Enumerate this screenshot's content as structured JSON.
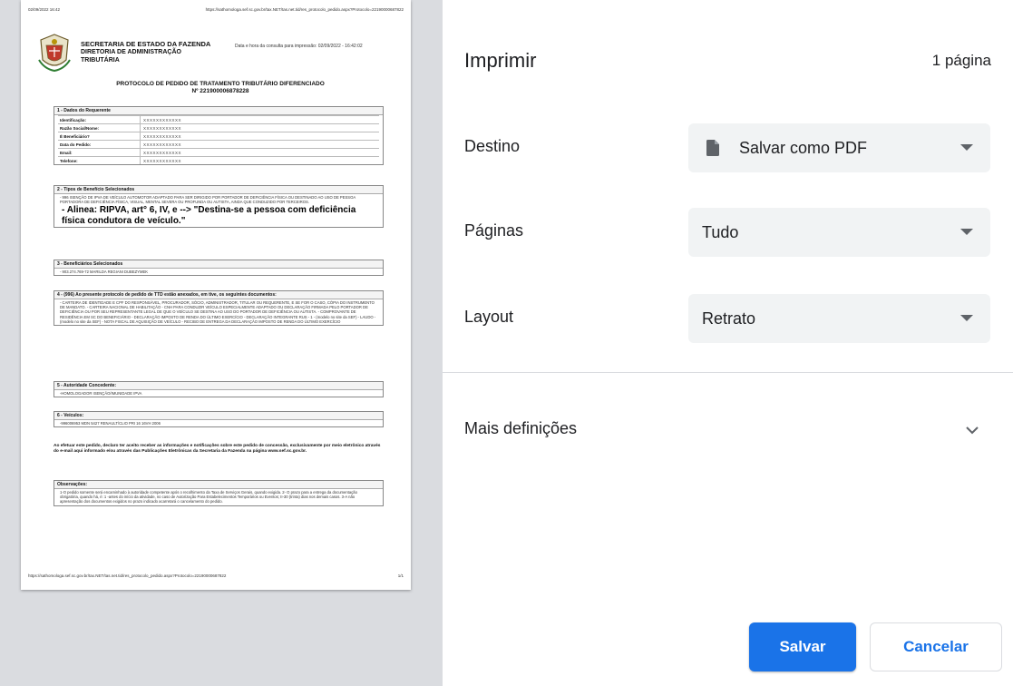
{
  "preview": {
    "header_left": "02/09/2022 16:42",
    "header_right": "https://sathomologa.sef.sc.gov.br/tax.NET/tas.net.tid/res_protocolo_pedido.aspx?Protocolo=22190000687822",
    "org_line1": "SECRETARIA DE ESTADO DA FAZENDA",
    "org_line2": "DIRETORIA DE ADMINISTRAÇÃO TRIBUTÁRIA",
    "consult": "Data e hora da consulta para impressão: 02/09/2022 - 16:42:02",
    "doc_title": "PROTOCOLO DE PEDIDO DE TRATAMENTO TRIBUTÁRIO DIFERENCIADO",
    "doc_number": "Nº 221900006878228",
    "section1": {
      "heading": "1 - Dados do Requerente",
      "rows": [
        {
          "k": "Identificação:",
          "v": "XXXXXXXXXXXX"
        },
        {
          "k": "Razão Social/Nome:",
          "v": "XXXXXXXXXXXX"
        },
        {
          "k": "É Beneficiário?",
          "v": "XXXXXXXXXXXX"
        },
        {
          "k": "Data do Pedido:",
          "v": "XXXXXXXXXXXX"
        },
        {
          "k": "Email:",
          "v": "XXXXXXXXXXXX"
        },
        {
          "k": "Telefone:",
          "v": "XXXXXXXXXXXX"
        }
      ]
    },
    "section2": {
      "heading": "2 - Tipos de Benefício Selecionados",
      "text": "- 996 ISENÇÃO DE IPVA DE VEÍCULO AUTOMOTOR ADAPTADO PARA SER DIRIGIDO POR PORTADOR DE DEFICIÊNCIA FÍSICA OU DESTINADO AO USO DE PESSOA PORTADORA DE DEFICIÊNCIA FÍSICA, VISUAL, MENTAL SEVERA OU PROFUNDA OU AUTISTA, AINDA QUE CONDUZIDO POR TERCEIROS.",
      "big": "- Alinea: RIPVA, art° 6, IV, e --> \"Destina-se a pessoa com deficiência física condutora de veículo.\""
    },
    "section3": {
      "heading": "3 - Beneficiários Selecionados",
      "text": "- 903.274.769-72 MARILDA REGIANI DUBEZYMEK"
    },
    "section4": {
      "heading": "4 - (996) Ao presente protocolo de pedido de TTD estão anexados, em tive, os seguintes documentos:",
      "text": "- CARTEIRA DE IDENTIDADE E CPF DO RESPONSÁVEL, PROCURADOR, SÓCIO, ADMINISTRADOR, TITULAR OU REQUERENTE, E SE FOR O CASO, CÓPIA DO INSTRUMENTO DE MANDATO. - CARTEIRA NACIONAL DE HABILITAÇÃO - CNH PARA CONDUZIR VEÍCULO ESPECIALMENTE ADAPTADO OU DECLARAÇÃO FIRMADA PELO PORTADOR DE DEFICIÊNCIA OU POR SEU REPRESENTANTE LEGAL DE QUE O VEÍCULO SE DESTINA AO USO DO PORTADOR DE DEFICIÊNCIA OU AUTISTA. - COMPROVANTE DE RESIDÊNCIA EM SC DO BENEFICIÁRIO - DECLARAÇÃO IMPOSTO DE RENDA DO ÚLTIMO EXERCÍCIO - DECLARAÇÃO INTEGRANTE RUS - 1 - (modelo no site da SEF) - LAUDO - (modelo no site da SEF) - NOTA FISCAL DE AQUISIÇÃO DE VEÍCULO - RECIBO DE ENTREGA DA DECLARAÇÃO IMPOSTO DE RENDA DO ÚLTIMO EXERCÍCIO"
    },
    "section5": {
      "heading": "5 - Autoridade Concedente:",
      "text": "-HOMOLOGADOR ISENÇÃO/IMUNIDADE IPVA"
    },
    "section6": {
      "heading": "6 - Veículos:",
      "text": "-996006953 MDN 5427 RENAULT/CLIO PRI 16 16VH 2006"
    },
    "declaration": "Ao efetuar este pedido, declaro ter aceito receber as informações e notificações sobre este pedido de concessão, exclusivamente por meio eletrônico através do e-mail aqui informado e/ou através das Publicações Eletrônicas da Secretaria da Fazenda na página www.sef.sc.gov.br.",
    "observations": {
      "heading": "Observações:",
      "text": "1-O pedido somente será encaminhado à autoridade competente após o recolhimento da Taxa de Serviços Gerais, quando exigida. 2- O prazo para a entrega da documentação obrigatória, quando há, é: 1 -antes do início da atividade, no caso de Autorização Para Estabelecimentos Temporários ou Eventos; II-30 (trinta) dias nos demais casos. 3-A não apresentação dos documentos exigidos no prazo indicado acarretará o cancelamento do pedido."
    },
    "footer_left": "https://sathomologa.sef.sc.gov.br/tax.NET/tas.net.tid/res_protocolo_pedido.aspx?Protocolo=22190000687822",
    "footer_right": "1/1"
  },
  "print": {
    "title": "Imprimir",
    "page_count": "1 página",
    "destination_label": "Destino",
    "destination_value": "Salvar como PDF",
    "pages_label": "Páginas",
    "pages_value": "Tudo",
    "layout_label": "Layout",
    "layout_value": "Retrato",
    "more_settings": "Mais definições",
    "save_button": "Salvar",
    "cancel_button": "Cancelar"
  },
  "colors": {
    "accent": "#1a73e8",
    "select_bg": "#f1f3f4",
    "preview_bg": "#dadce0"
  },
  "icons": [
    "document-icon",
    "chevron-down-icon",
    "crest-icon"
  ]
}
